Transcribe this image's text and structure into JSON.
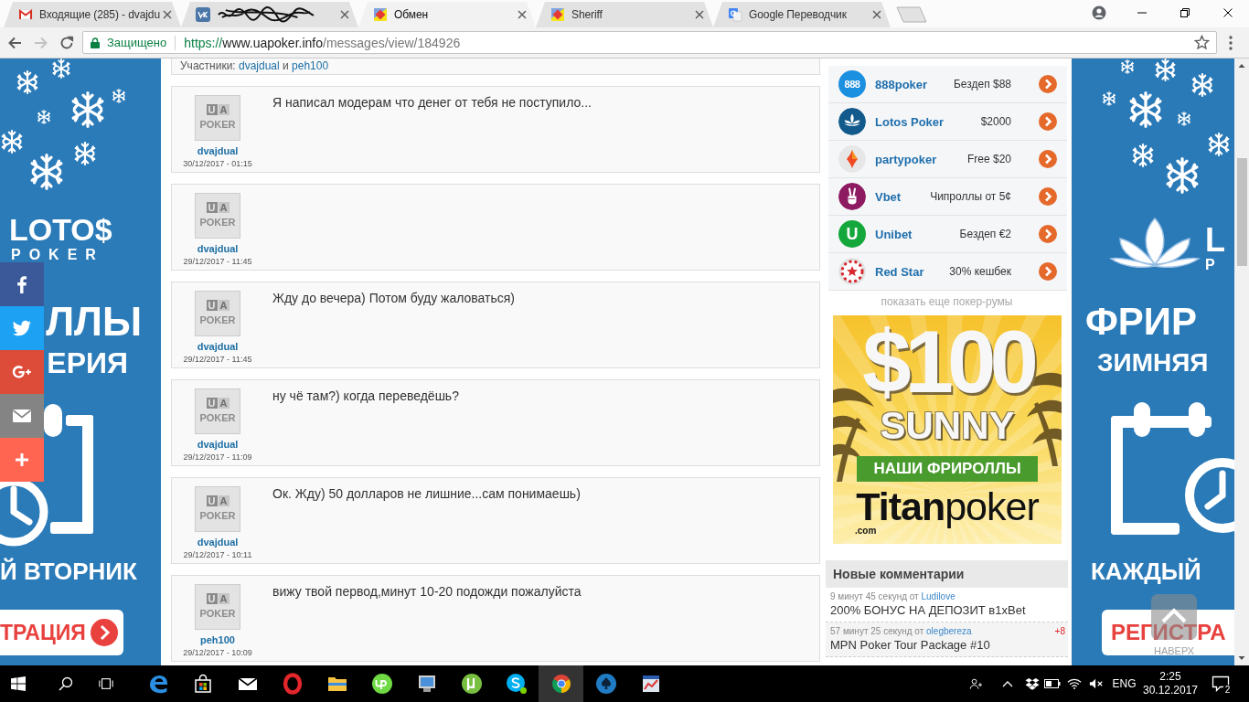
{
  "browser": {
    "tabs": [
      {
        "kind": "gmail",
        "title": "Входящие (285) - dvajdu",
        "redacted": false,
        "selected": false
      },
      {
        "kind": "vk",
        "redacted": true,
        "selected": false
      },
      {
        "kind": "uapoker",
        "title": "Обмен",
        "redacted": false,
        "selected": true
      },
      {
        "kind": "uapoker",
        "title": "Sheriff",
        "redacted": false,
        "selected": false
      },
      {
        "kind": "translate",
        "title": "Google Переводчик",
        "redacted": false,
        "selected": false
      }
    ],
    "back": {
      "disabled": false
    },
    "forward": {
      "disabled": true
    },
    "address_bar": {
      "security_label": "Защищено",
      "url_scheme": "https://",
      "url_host": "www.uapoker.info",
      "url_path": "/messages/view/184926"
    }
  },
  "left_ad": {
    "logo_word": "LOTO$",
    "logo_subword": "POKER",
    "line_1": "ЛЛЫ",
    "line_2": "ЕРИЯ",
    "line_3": "Й ВТОРНИК",
    "button": "ТРАЦИЯ"
  },
  "share_buttons": [
    {
      "kind": "facebook"
    },
    {
      "kind": "twitter"
    },
    {
      "kind": "google_plus"
    },
    {
      "kind": "email"
    },
    {
      "kind": "more"
    }
  ],
  "conversation": {
    "label": "Участники:",
    "participants": [
      "dvajdual",
      "peh100"
    ],
    "joiner": "и"
  },
  "messages": [
    {
      "avatar": [
        "U",
        "A",
        "POKER"
      ],
      "author": "dvajdual",
      "date": "30/12/2017 - 01:15",
      "text": "Я написал модерам что денег от тебя не поступило..."
    },
    {
      "avatar": [
        "U",
        "A",
        "POKER"
      ],
      "author": "dvajdual",
      "date": "29/12/2017 - 11:45"
    },
    {
      "avatar": [
        "U",
        "A",
        "POKER"
      ],
      "author": "dvajdual",
      "date": "29/12/2017 - 11:45",
      "text": "Жду до вечера) Потом буду жаловаться)"
    },
    {
      "avatar": [
        "U",
        "A",
        "POKER"
      ],
      "author": "dvajdual",
      "date": "29/12/2017 - 11:09",
      "text": "ну чё там?) когда переведёшь?"
    },
    {
      "avatar": [
        "U",
        "A",
        "POKER"
      ],
      "author": "dvajdual",
      "date": "29/12/2017 - 10:11",
      "text": "Ок. Жду) 50 долларов не лишние...сам понимаешь)"
    },
    {
      "avatar": [
        "U",
        "A",
        "POKER"
      ],
      "author": "peh100",
      "date": "29/12/2017 - 10:09",
      "text": "вижу твой первод,минут 10-20 подожди пожалуйста"
    }
  ],
  "poker_rooms": [
    {
      "kind": "eights",
      "logo_text": "888",
      "name": "888poker",
      "bonus": "Бездеп $88"
    },
    {
      "kind": "lotus",
      "name": "Lotos Poker",
      "bonus": "$2000"
    },
    {
      "kind": "party",
      "name": "partypoker",
      "bonus": "Free $20"
    },
    {
      "kind": "vbet",
      "name": "Vbet",
      "bonus": "Чипроллы от 5¢"
    },
    {
      "kind": "unibet",
      "logo_text": "U",
      "name": "Unibet",
      "bonus": "Бездеп €2"
    },
    {
      "kind": "redstar",
      "name": "Red Star",
      "bonus": "30% кешбек"
    }
  ],
  "more_rooms": "показать еще покер-румы",
  "banner": {
    "amount": "$100",
    "word": "SUNNY",
    "ribbon": "НАШИ ФРИРОЛЛЫ",
    "brand": "**Titan**poker",
    "domain": ".com"
  },
  "comments": {
    "title": "Новые комментарии",
    "items": [
      {
        "age": "9 минут 45 секунд от",
        "author": "Ludilove",
        "title": "200% БОНУС НА ДЕПОЗИТ в1xBet"
      },
      {
        "age": "57 минут 25 секунд от",
        "author": "olegbereza",
        "score": "+8",
        "title": "MPN Poker Tour Package #10"
      }
    ]
  },
  "right_ad": {
    "logo_word": "L",
    "logo_subword": "P",
    "line_1": "ФРИР",
    "line_2": "ЗИМНЯЯ",
    "line_3": "КАЖДЫЙ",
    "button": "РЕГИСТРА"
  },
  "back_to_top": "НАВЕРХ",
  "taskbar": {
    "apps": [
      {
        "kind": "edge",
        "active": false
      },
      {
        "kind": "store",
        "active": false
      },
      {
        "kind": "mail",
        "active": false
      },
      {
        "kind": "opera",
        "active": false
      },
      {
        "kind": "explorer",
        "active": false
      },
      {
        "kind": "upwork",
        "active": false
      },
      {
        "kind": "monitor",
        "active": false
      },
      {
        "kind": "utorrent",
        "active": false
      },
      {
        "kind": "skype",
        "active": false
      },
      {
        "kind": "chrome",
        "active": true
      },
      {
        "kind": "spade",
        "active": false
      },
      {
        "kind": "chart",
        "active": false
      }
    ],
    "language": "ENG",
    "time": "2:25",
    "date": "30.12.2017",
    "notifications": "2"
  }
}
